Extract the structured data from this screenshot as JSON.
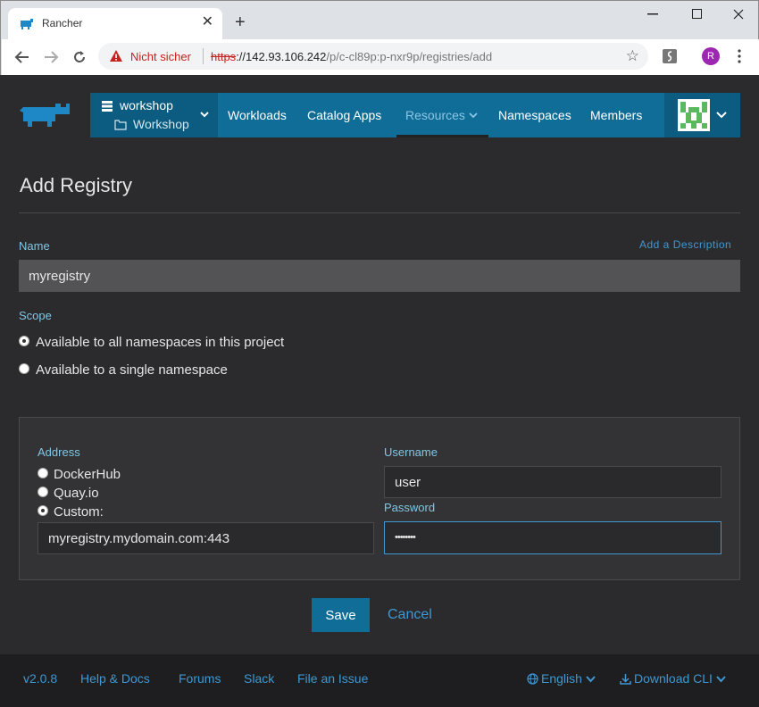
{
  "browser": {
    "tab_title": "Rancher",
    "tab_close": "✕",
    "new_tab": "+",
    "not_secure": "Nicht sicher",
    "url_scheme": "https",
    "url_host": "://142.93.106.242",
    "url_path": "/p/c-cl89p:p-nxr9p/registries/add",
    "profile_initial": "R"
  },
  "nav": {
    "cluster": "workshop",
    "project": "Workshop",
    "items": [
      "Workloads",
      "Catalog Apps",
      "Resources",
      "Namespaces",
      "Members"
    ],
    "active": "Resources"
  },
  "page": {
    "title": "Add Registry",
    "name_label": "Name",
    "add_description": "Add a Description",
    "name_value": "myregistry",
    "scope_label": "Scope",
    "scope_options": [
      "Available to all namespaces in this project",
      "Available to a single namespace"
    ],
    "scope_selected": 0
  },
  "registry": {
    "address_label": "Address",
    "address_options": [
      "DockerHub",
      "Quay.io",
      "Custom:"
    ],
    "address_selected": 2,
    "custom_value": "myregistry.mydomain.com:443",
    "username_label": "Username",
    "username_value": "user",
    "password_label": "Password",
    "password_value": "••••••••"
  },
  "actions": {
    "save": "Save",
    "cancel": "Cancel"
  },
  "footer": {
    "version": "v2.0.8",
    "help": "Help & Docs",
    "forums": "Forums",
    "slack": "Slack",
    "issue": "File an Issue",
    "language": "English",
    "download": "Download CLI"
  },
  "colors": {
    "accent": "#0f6d97",
    "link": "#3d98d3",
    "label": "#7fc7e4",
    "background": "#2b2b2d"
  }
}
